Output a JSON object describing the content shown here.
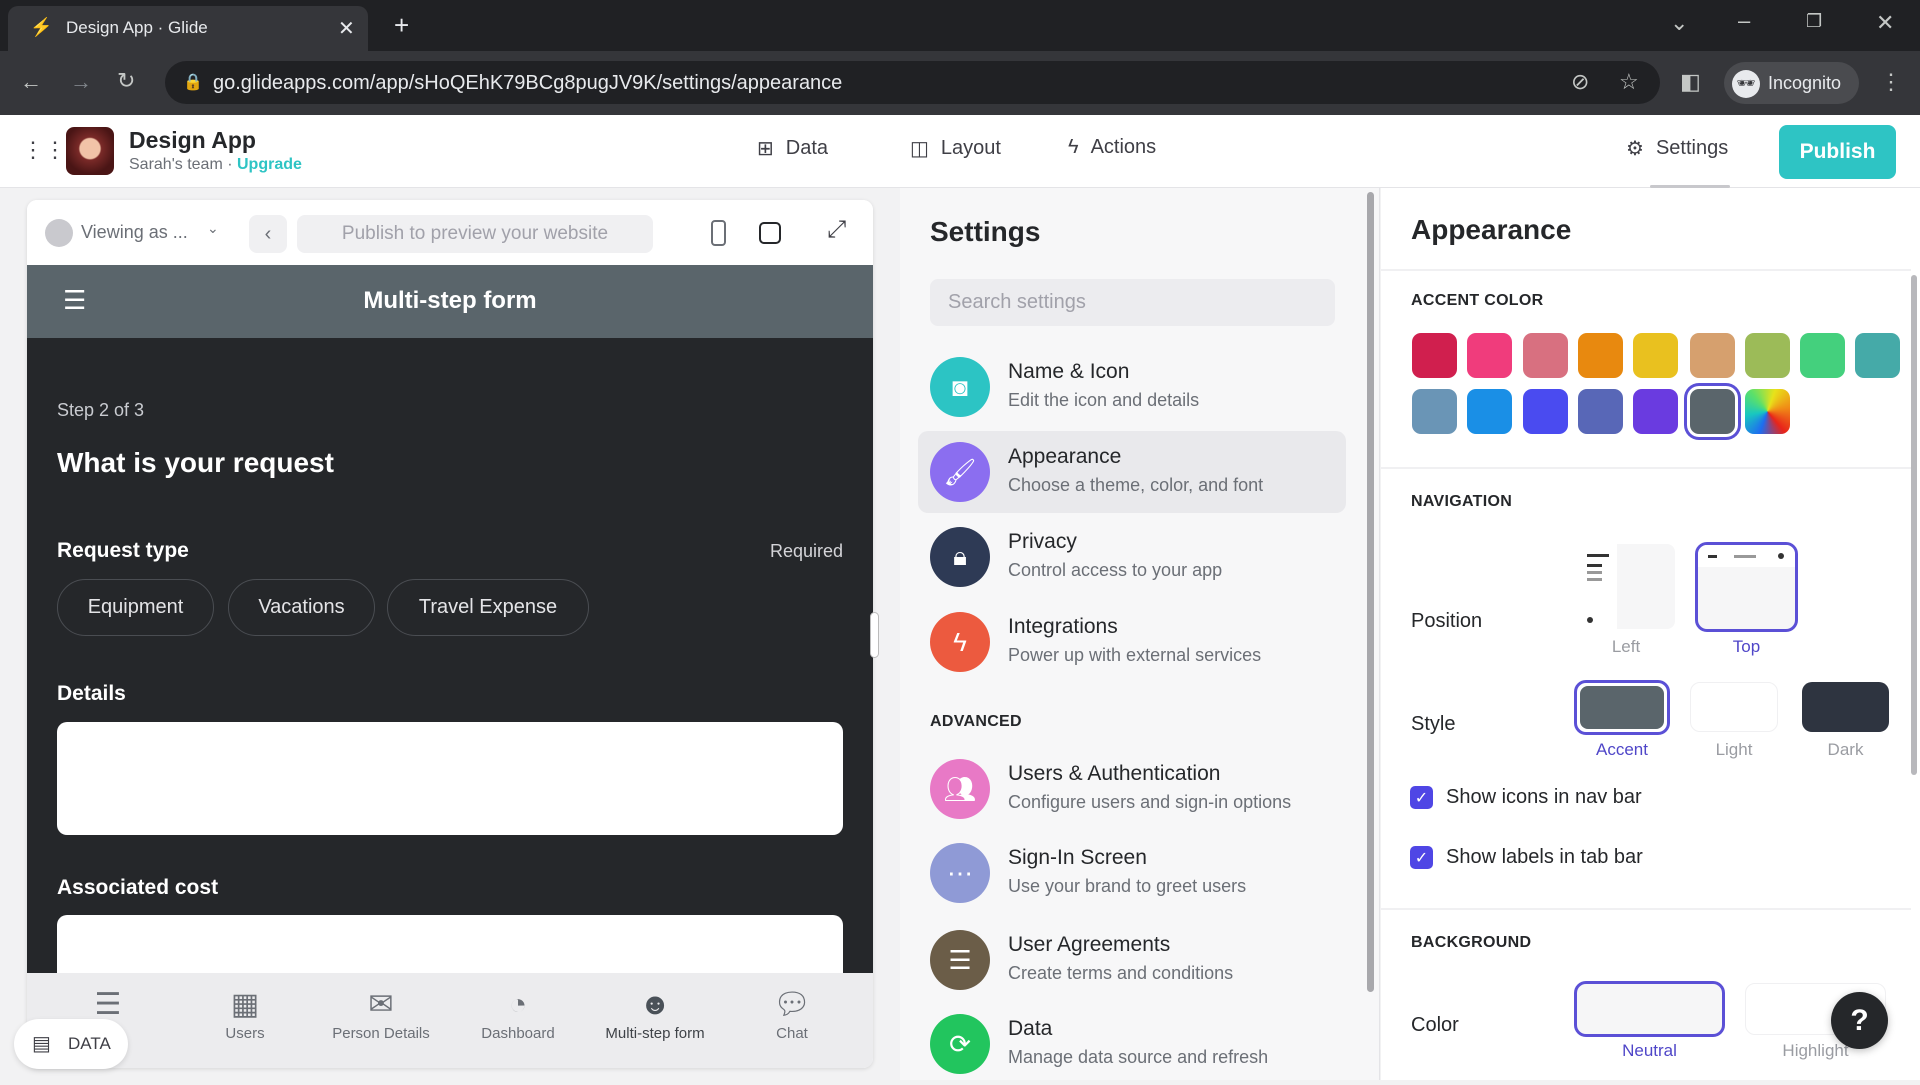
{
  "browser": {
    "tab_title": "Design App · Glide",
    "url": "go.glideapps.com/app/sHoQEhK79BCg8pugJV9K/settings/appearance",
    "profile": "Incognito"
  },
  "header": {
    "app_name": "Design App",
    "team": "Sarah's team · ",
    "upgrade": "Upgrade",
    "nav": [
      "Data",
      "Layout",
      "Actions"
    ],
    "settings": "Settings",
    "publish": "Publish"
  },
  "preview": {
    "viewing_as": "Viewing as ...",
    "publish_placeholder": "Publish to preview your website",
    "screen_title": "Multi-step form",
    "step": "Step 2 of 3",
    "question": "What is your request",
    "request_type": "Request type",
    "required": "Required",
    "chips": [
      "Equipment",
      "Vacations",
      "Travel Expense"
    ],
    "details": "Details",
    "associated_cost": "Associated cost",
    "tabs": [
      "Support",
      "Users",
      "Person Details",
      "Dashboard",
      "Multi-step form",
      "Chat"
    ],
    "tab_visible_suffix": "port",
    "data_pill": "DATA"
  },
  "settings": {
    "title": "Settings",
    "search_placeholder": "Search settings",
    "items": [
      {
        "title": "Name & Icon",
        "subtitle": "Edit the icon and details",
        "color": "#2cc4c4"
      },
      {
        "title": "Appearance",
        "subtitle": "Choose a theme, color, and font",
        "color": "#8b6ef0"
      },
      {
        "title": "Privacy",
        "subtitle": "Control access to your app",
        "color": "#2e3a55"
      },
      {
        "title": "Integrations",
        "subtitle": "Power up with external services",
        "color": "#ec5a3f"
      }
    ],
    "advanced_label": "ADVANCED",
    "advanced": [
      {
        "title": "Users & Authentication",
        "subtitle": "Configure users and sign-in options",
        "color": "#e879c6"
      },
      {
        "title": "Sign-In Screen",
        "subtitle": "Use your brand to greet users",
        "color": "#8f9ad6"
      },
      {
        "title": "User Agreements",
        "subtitle": "Create terms and conditions",
        "color": "#6b5d48"
      },
      {
        "title": "Data",
        "subtitle": "Manage data source and refresh",
        "color": "#22c55e"
      }
    ]
  },
  "appearance": {
    "title": "Appearance",
    "accent_label": "ACCENT COLOR",
    "accent_colors": [
      "#d01f4e",
      "#f03c7c",
      "#d87080",
      "#e8890f",
      "#e9c11f",
      "#d6a06e",
      "#9cbb58",
      "#44d07d",
      "#45aaa8",
      "#6a95b6",
      "#1a8fe6",
      "#4a4bf0",
      "#5867b7",
      "#6a3be0",
      "#5a656b",
      "rainbow"
    ],
    "accent_selected": "#5a656b",
    "navigation_label": "NAVIGATION",
    "position_label": "Position",
    "position_options": [
      "Left",
      "Top"
    ],
    "position_selected": "Top",
    "style_label": "Style",
    "style_options": [
      "Accent",
      "Light",
      "Dark"
    ],
    "style_selected": "Accent",
    "show_icons": "Show icons in nav bar",
    "show_icons_checked": true,
    "show_labels": "Show labels in tab bar",
    "show_labels_checked": true,
    "background_label": "BACKGROUND",
    "color_label": "Color",
    "color_options": [
      "Neutral",
      "Highlight"
    ],
    "color_selected": "Neutral"
  },
  "help": "?"
}
